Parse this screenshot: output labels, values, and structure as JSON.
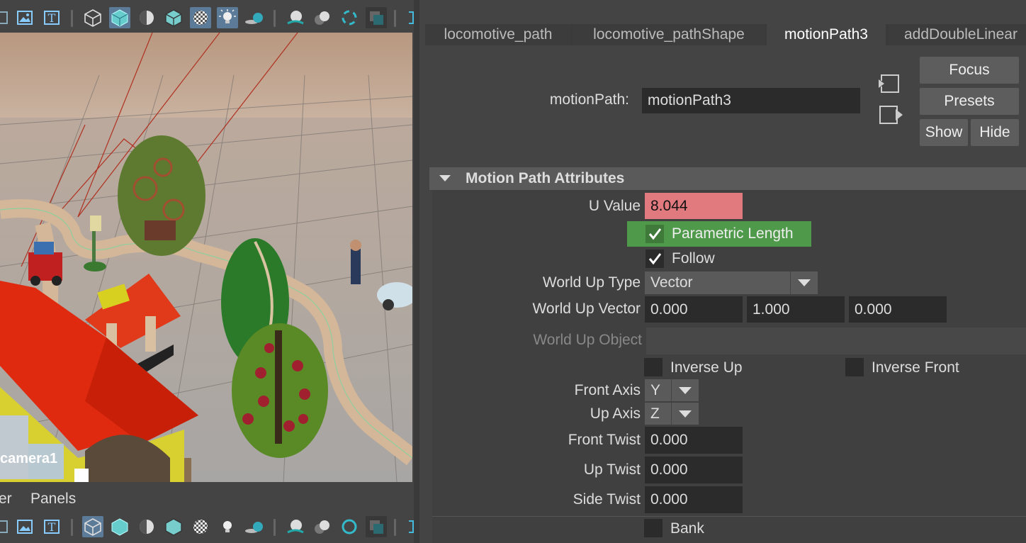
{
  "viewport": {
    "camera_label": "camera1",
    "menu_partial": "er",
    "menu_panels": "Panels"
  },
  "attribute_editor": {
    "tabs": [
      {
        "label": "locomotive_path",
        "active": false
      },
      {
        "label": "locomotive_pathShape",
        "active": false
      },
      {
        "label": "motionPath3",
        "active": true
      },
      {
        "label": "addDoubleLinear",
        "active": false
      }
    ],
    "node_label": "motionPath:",
    "node_value": "motionPath3",
    "buttons": {
      "focus": "Focus",
      "presets": "Presets",
      "show": "Show",
      "hide": "Hide"
    },
    "section_title": "Motion Path Attributes",
    "u_value": {
      "label": "U Value",
      "value": "8.044",
      "keyed_color": "#e07a7e"
    },
    "parametric_length": {
      "label": "Parametric Length",
      "checked": true,
      "highlight_color": "#4f9a4a"
    },
    "follow": {
      "label": "Follow",
      "checked": true
    },
    "world_up_type": {
      "label": "World Up Type",
      "value": "Vector"
    },
    "world_up_vector": {
      "label": "World Up Vector",
      "x": "0.000",
      "y": "1.000",
      "z": "0.000"
    },
    "world_up_object": {
      "label": "World Up Object",
      "value": ""
    },
    "inverse_up": {
      "label": "Inverse Up",
      "checked": false
    },
    "inverse_front": {
      "label": "Inverse Front",
      "checked": false
    },
    "front_axis": {
      "label": "Front Axis",
      "value": "Y"
    },
    "up_axis": {
      "label": "Up Axis",
      "value": "Z"
    },
    "front_twist": {
      "label": "Front Twist",
      "value": "0.000"
    },
    "up_twist": {
      "label": "Up Twist",
      "value": "0.000"
    },
    "side_twist": {
      "label": "Side Twist",
      "value": "0.000"
    },
    "bank": {
      "label": "Bank",
      "checked": false
    }
  }
}
